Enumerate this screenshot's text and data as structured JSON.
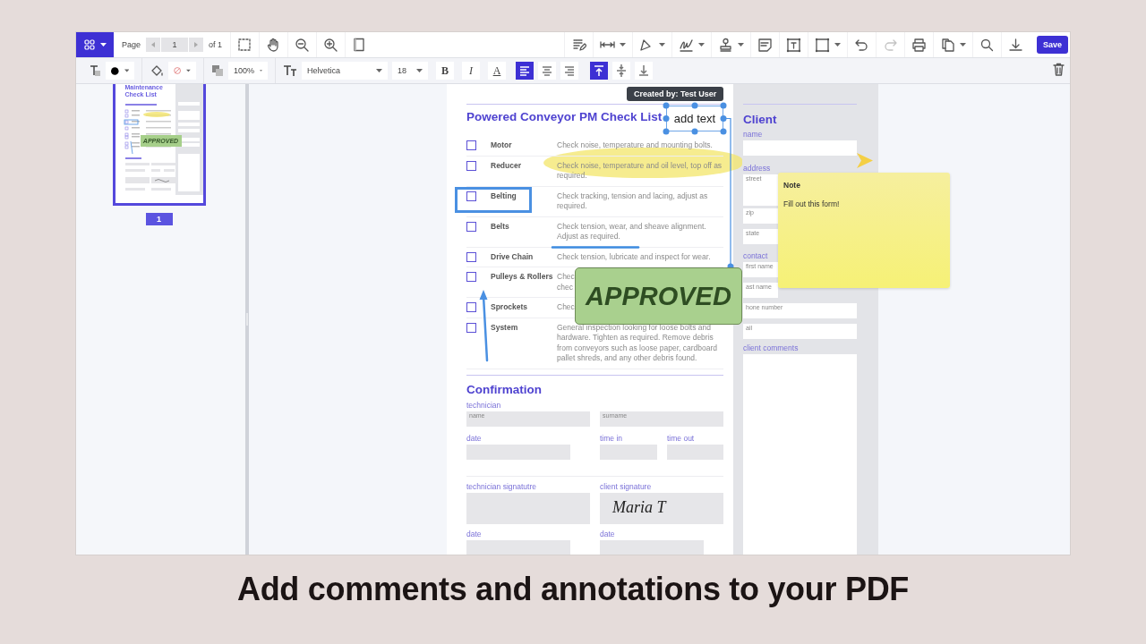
{
  "toolbar": {
    "app_menu": {
      "dropdown": true
    },
    "page_label": "Page",
    "page_input": "1",
    "page_total": "of 1",
    "view_tools": [
      {
        "dropdown": false,
        "disabled": false
      },
      {
        "dropdown": false,
        "disabled": false
      },
      {
        "dropdown": false,
        "disabled": false
      },
      {
        "dropdown": false,
        "disabled": false
      },
      {
        "dropdown": false,
        "disabled": false
      }
    ],
    "tools": [
      {
        "dropdown": false,
        "disabled": false
      },
      {
        "dropdown": true,
        "disabled": false
      },
      {
        "dropdown": true,
        "disabled": false
      },
      {
        "dropdown": true,
        "disabled": false
      },
      {
        "dropdown": true,
        "disabled": false
      },
      {
        "dropdown": false,
        "disabled": false
      },
      {
        "dropdown": false,
        "disabled": false
      },
      {
        "dropdown": true,
        "disabled": false
      },
      {
        "dropdown": false,
        "disabled": false
      },
      {
        "dropdown": false,
        "disabled": true
      },
      {
        "dropdown": false,
        "disabled": false
      },
      {
        "dropdown": true,
        "disabled": false
      },
      {
        "dropdown": false,
        "disabled": false
      },
      {
        "dropdown": false,
        "disabled": false
      }
    ],
    "save": "Save"
  },
  "format_bar": {
    "opacity": "100%",
    "font": "Helvetica",
    "size": "18",
    "styles": [
      {
        "label": "B",
        "kind": "bold"
      },
      {
        "label": "I",
        "kind": "italic"
      },
      {
        "label": "A",
        "kind": "color"
      }
    ],
    "align": [
      {
        "selected": true
      },
      {
        "selected": false
      },
      {
        "selected": false
      }
    ],
    "valign": [
      {
        "selected": true
      },
      {
        "selected": false
      },
      {
        "selected": false
      }
    ]
  },
  "sidebar": {
    "thumbnail": {
      "title": "Maintenance Check List",
      "stamp": "APPROVED"
    },
    "pages": [
      {
        "label": "1",
        "selected": true
      }
    ]
  },
  "document": {
    "title": "Powered Conveyor PM Check List",
    "rows": [
      {
        "name": "Motor",
        "description": "Check noise, temperature and mounting bolts.",
        "checked": false
      },
      {
        "name": "Reducer",
        "description": "Check noise, temperature and oil level, top off as required.",
        "checked": false
      },
      {
        "name": "Belting",
        "description": "Check tracking, tension and lacing, adjust as required.",
        "checked": false
      },
      {
        "name": "Belts",
        "description": "Check tension, wear, and sheave alignment. Adjust as required.",
        "checked": false
      },
      {
        "name": "Drive Chain",
        "description": "Check tension, lubricate and inspect for wear.",
        "checked": false
      },
      {
        "name": "Pulleys & Rollers",
        "description": "Chec\nchec",
        "checked": false
      },
      {
        "name": "Sprockets",
        "description": "Chec",
        "checked": false
      },
      {
        "name": "System",
        "description": "General inspection looking for loose bolts and hardware. Tighten as required. Remove debris from conveyors such as loose paper, cardboard pallet shreds, and any other debris found.",
        "checked": false
      }
    ],
    "confirmation": {
      "title": "Confirmation",
      "technician": "technician",
      "name_placeholder": "name",
      "surname_placeholder": "surname",
      "date": "date",
      "time_in": "time in",
      "time_out": "time out",
      "technician_signature": "technician signatutre",
      "client_signature": "client signature",
      "signature_value": "Maria T",
      "date_left": "date",
      "date_right": "date"
    },
    "client": {
      "title": "Client",
      "name": "name",
      "address": "address",
      "street": "street",
      "zip": "zip",
      "state": "state",
      "contact": "contact",
      "fields": [
        "first name",
        "ast name",
        "hone number",
        "ail"
      ],
      "comments": "client comments"
    }
  },
  "annotations": {
    "tooltip": "Created by: Test User",
    "free_text": "add text",
    "stamp": "APPROVED",
    "note": {
      "title": "Note",
      "body": "Fill out this form!"
    }
  },
  "caption": "Add comments and annotations to your PDF"
}
